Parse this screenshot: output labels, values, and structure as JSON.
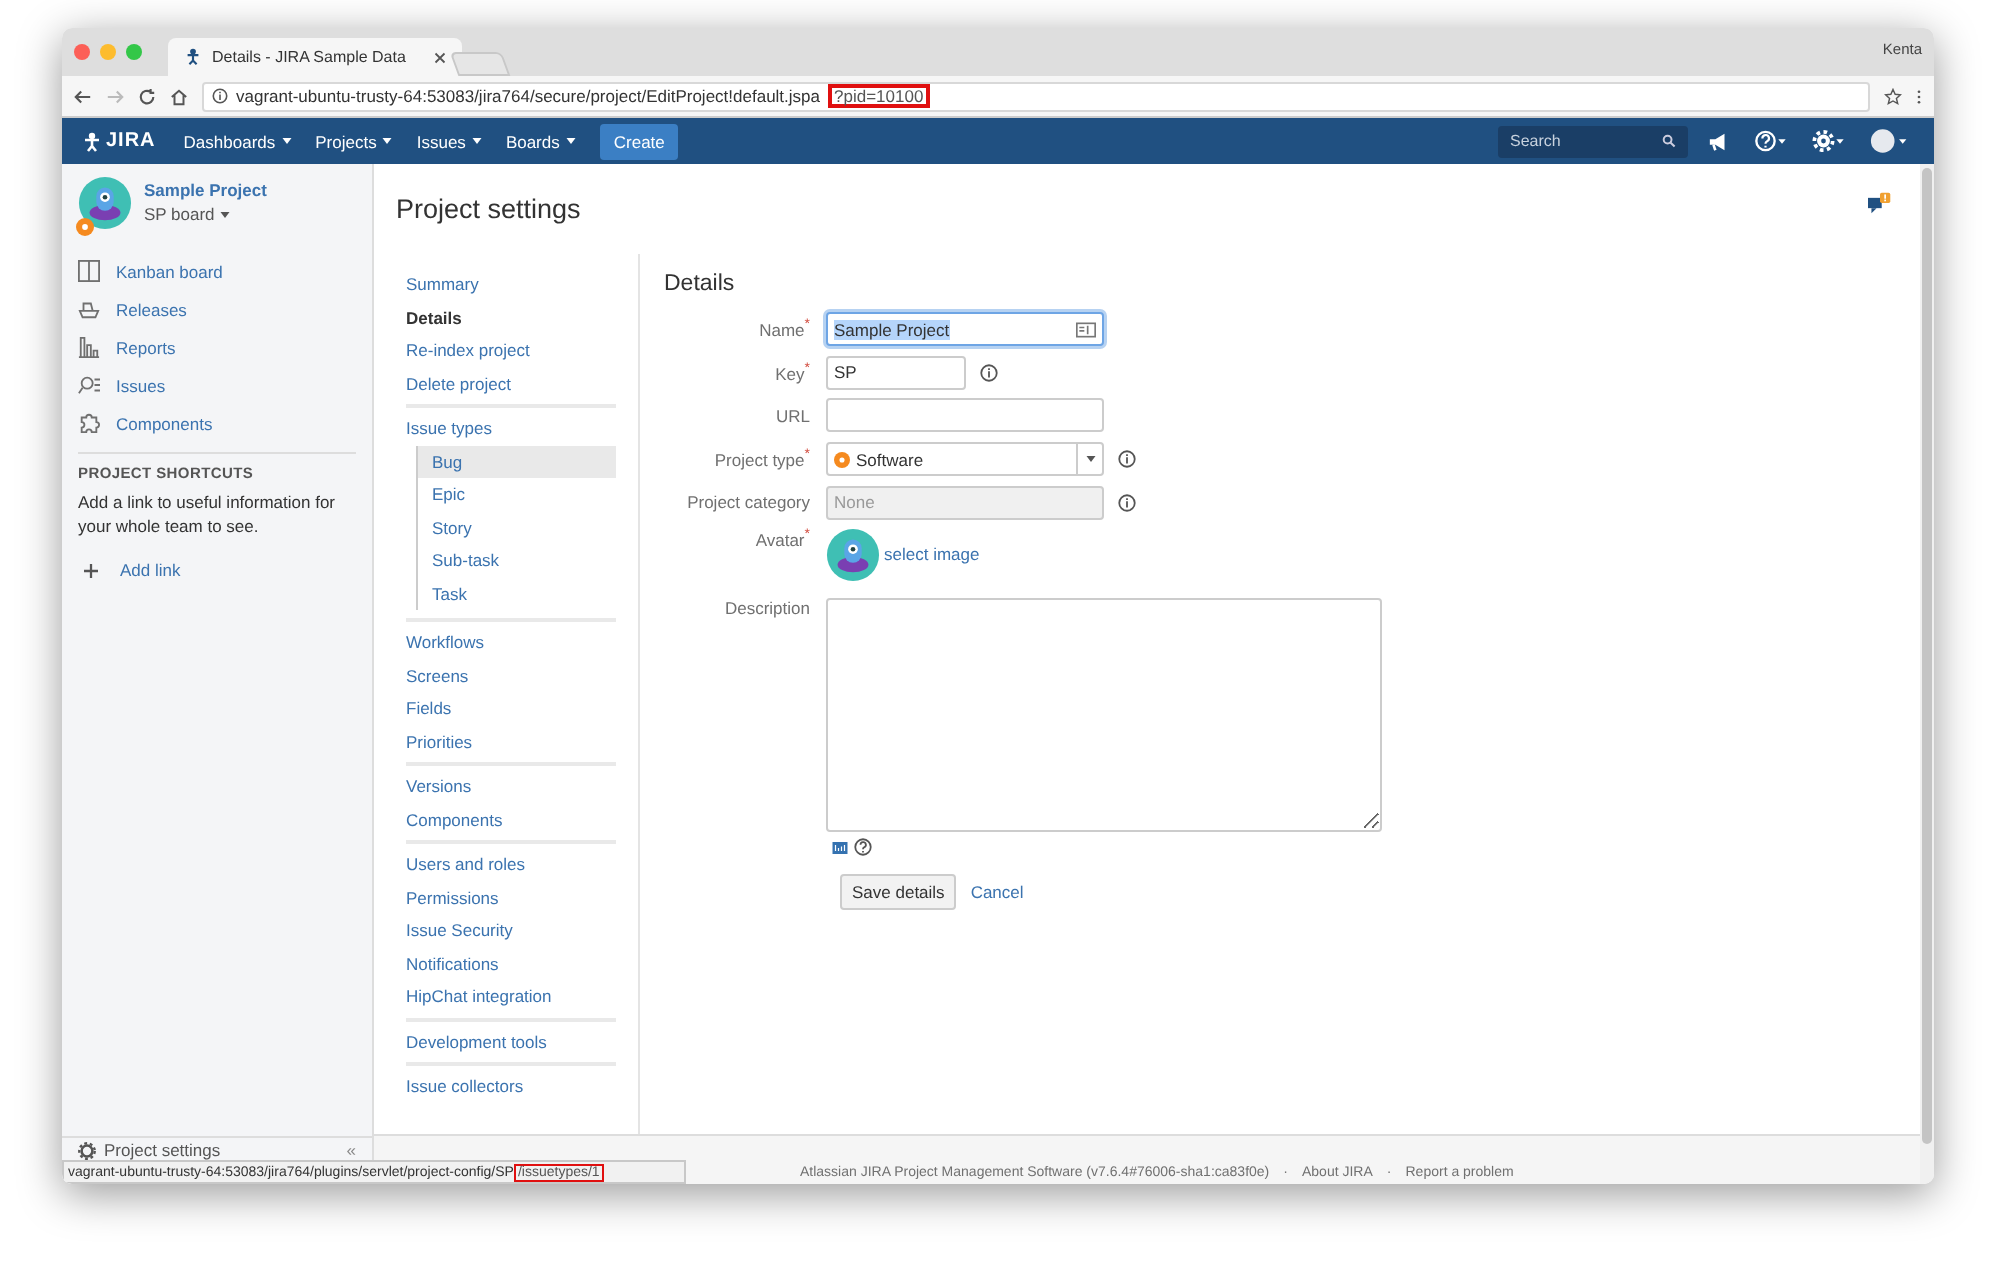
{
  "browser": {
    "tabs": [
      {
        "title": "Details - JIRA Sample Data",
        "selected": true
      }
    ],
    "user": "Kenta",
    "url": {
      "base": "vagrant-ubuntu-trusty-64:53083/jira764/secure/project/EditProject!default.jspa",
      "highlight": "?pid=10100"
    }
  },
  "header": {
    "logo": "JIRA",
    "menus": [
      {
        "label": "Dashboards"
      },
      {
        "label": "Projects"
      },
      {
        "label": "Issues"
      },
      {
        "label": "Boards"
      }
    ],
    "create": "Create",
    "search": {
      "placeholder": "Search"
    }
  },
  "sidebar": {
    "project": "Sample Project",
    "board": "SP board",
    "items": [
      {
        "label": "Kanban board",
        "kind": "board"
      },
      {
        "label": "Releases",
        "kind": "releases"
      },
      {
        "label": "Reports",
        "kind": "reports"
      },
      {
        "label": "Issues",
        "kind": "issues"
      },
      {
        "label": "Components",
        "kind": "components"
      }
    ],
    "shortcuts_title": "PROJECT SHORTCUTS",
    "shortcuts_text": "Add a link to useful information for your whole team to see.",
    "add_link": "Add link",
    "footer": "Project settings",
    "collapse": "«"
  },
  "page_title": "Project settings",
  "settings_nav": [
    [
      {
        "label": "Summary",
        "selected": false
      },
      {
        "label": "Details",
        "selected": true
      },
      {
        "label": "Re-index project",
        "selected": false
      },
      {
        "label": "Delete project",
        "selected": false
      }
    ],
    [
      {
        "label": "Issue types",
        "selected": false,
        "children": [
          {
            "label": "Bug",
            "selected": true
          },
          {
            "label": "Epic",
            "selected": false
          },
          {
            "label": "Story",
            "selected": false
          },
          {
            "label": "Sub-task",
            "selected": false
          },
          {
            "label": "Task",
            "selected": false
          }
        ]
      }
    ],
    [
      {
        "label": "Workflows",
        "selected": false
      },
      {
        "label": "Screens",
        "selected": false
      },
      {
        "label": "Fields",
        "selected": false
      },
      {
        "label": "Priorities",
        "selected": false
      }
    ],
    [
      {
        "label": "Versions",
        "selected": false
      },
      {
        "label": "Components",
        "selected": false
      }
    ],
    [
      {
        "label": "Users and roles",
        "selected": false
      },
      {
        "label": "Permissions",
        "selected": false
      },
      {
        "label": "Issue Security",
        "selected": false
      },
      {
        "label": "Notifications",
        "selected": false
      },
      {
        "label": "HipChat integration",
        "selected": false
      }
    ],
    [
      {
        "label": "Development tools",
        "selected": false
      }
    ],
    [
      {
        "label": "Issue collectors",
        "selected": false
      }
    ]
  ],
  "form": {
    "title": "Details",
    "fields": [
      {
        "label": "Name$^{*}$",
        "kind": "text",
        "value": "Sample Project",
        "focused": true,
        "addon": true,
        "disabled": false
      },
      {
        "label": "Key$^{*}$",
        "kind": "short_text",
        "value": "SP",
        "focused": false,
        "info": true,
        "disabled": false
      },
      {
        "label": "URL",
        "kind": "text",
        "focused": false,
        "disabled": false
      },
      {
        "label": "Project type$^{*}$",
        "kind": "select",
        "value": "Software",
        "focused": false,
        "info": true,
        "disabled": false
      },
      {
        "label": "Project category",
        "kind": "text",
        "value": "None",
        "focused": false,
        "info": true,
        "disabled": true
      },
      {
        "label": "Avatar$^{*}$",
        "kind": "avatar",
        "link": "select image"
      },
      {
        "label": "Description",
        "kind": "textarea",
        "focused": false
      }
    ],
    "save": "Save details",
    "cancel": "Cancel"
  },
  "footer": {
    "text": "Atlassian JIRA Project Management Software (v7.6.4#76006-sha1:ca83f0e)",
    "separator": "·",
    "links": [
      "About JIRA",
      "Report a problem"
    ]
  },
  "status_url": {
    "base": "vagrant-ubuntu-trusty-64:53083/jira764/plugins/servlet/project-config/SP",
    "highlight": "/issuetypes/1"
  }
}
